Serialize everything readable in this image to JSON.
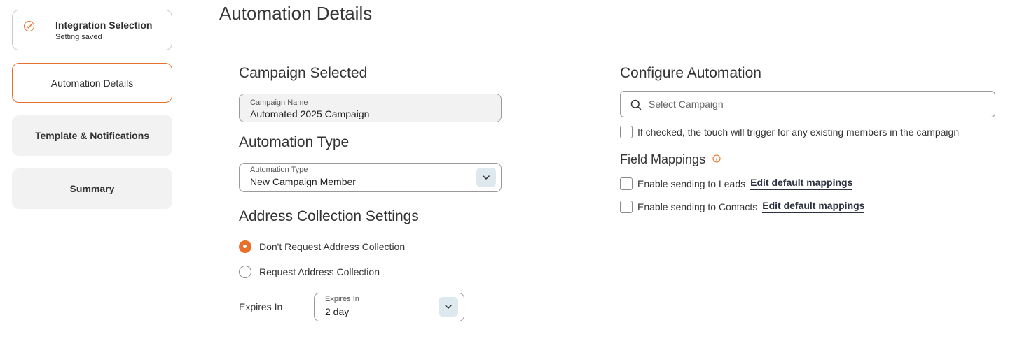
{
  "sidebar": {
    "steps": [
      {
        "label": "Integration Selection",
        "sub": "Setting saved",
        "state": "done"
      },
      {
        "label": "Automation Details",
        "state": "active"
      },
      {
        "label": "Template & Notifications",
        "state": "inactive"
      },
      {
        "label": "Summary",
        "state": "inactive"
      }
    ]
  },
  "page": {
    "title": "Automation Details"
  },
  "campaign": {
    "title": "Campaign Selected",
    "field_label": "Campaign Name",
    "field_value": "Automated 2025 Campaign"
  },
  "automation_type": {
    "title": "Automation Type",
    "field_label": "Automation Type",
    "field_value": "New Campaign Member"
  },
  "address": {
    "title": "Address Collection Settings",
    "options": [
      {
        "label": "Don't Request Address Collection",
        "selected": true
      },
      {
        "label": "Request Address Collection",
        "selected": false
      }
    ],
    "expires_label": "Expires In",
    "expires_field_label": "Expires In",
    "expires_value": "2 day"
  },
  "configure": {
    "title": "Configure Automation",
    "search_placeholder": "Select Campaign",
    "existing_members_label": "If checked, the touch will trigger for any existing members in the campaign",
    "existing_members_checked": false
  },
  "field_mappings": {
    "title": "Field Mappings",
    "leads_label": "Enable sending to Leads",
    "leads_checked": false,
    "leads_link": "Edit default mappings",
    "contacts_label": "Enable sending to Contacts",
    "contacts_checked": false,
    "contacts_link": "Edit default mappings"
  },
  "colors": {
    "accent": "#e8702a",
    "chevron_bg": "#dde9ee",
    "link": "#2c3240"
  }
}
